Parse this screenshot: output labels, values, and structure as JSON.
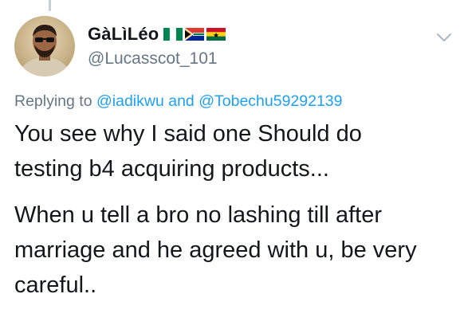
{
  "user": {
    "display_name": "GàLìLéo",
    "handle": "@Lucasscot_101",
    "flags": [
      "nigeria-flag",
      "south-africa-flag",
      "ghana-flag"
    ]
  },
  "reply": {
    "prefix": "Replying to",
    "mention_1": "@iadikwu",
    "conjunction": "and",
    "mention_2": "@Tobechu59292139"
  },
  "tweet": {
    "paragraph_1_line_1": "You see why I said one Should do",
    "paragraph_1_line_2": "testing b4 acquiring products...",
    "paragraph_2_line_1": "When u tell a bro no lashing till after",
    "paragraph_2_line_2": "marriage and he agreed with u, be very",
    "paragraph_2_line_3": "careful.."
  },
  "icons": {
    "menu": "chevron-down-icon",
    "avatar": "avatar"
  },
  "colors": {
    "text_primary": "#14171a",
    "text_secondary": "#657786",
    "link": "#1da1f2",
    "thread_line": "#c4cfd6"
  }
}
